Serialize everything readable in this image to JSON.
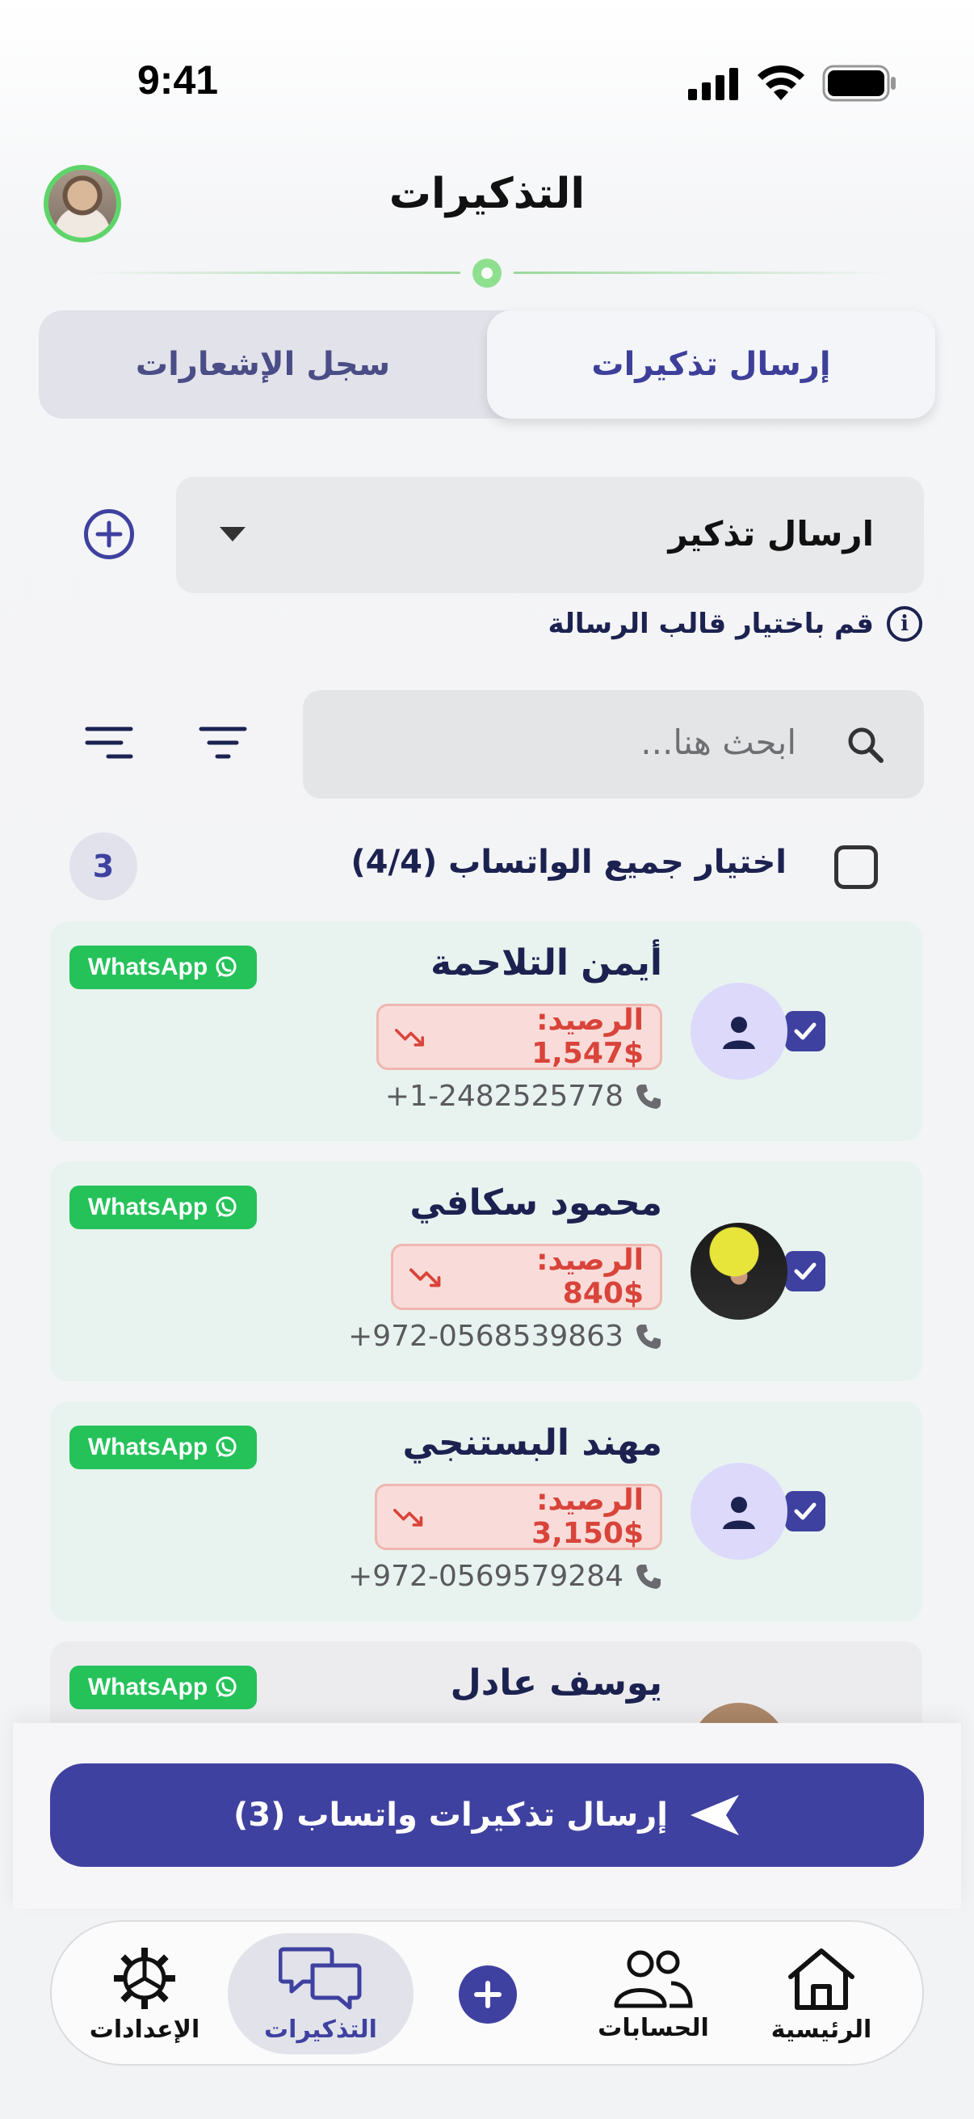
{
  "status_bar": {
    "time": "9:41"
  },
  "header": {
    "title": "التذكيرات"
  },
  "tabs": [
    {
      "label": "إرسال تذكيرات",
      "active": true
    },
    {
      "label": "سجل الإشعارات",
      "active": false
    }
  ],
  "template": {
    "selected": "ارسال تذكير",
    "hint": "قم باختيار قالب الرسالة"
  },
  "search": {
    "placeholder": "ابحث هنا..."
  },
  "select_all": {
    "label": "اختيار جميع الواتساب (4/4)",
    "selected_count": "3",
    "checked": false
  },
  "customers": [
    {
      "name": "أيمن التلاحمة",
      "balance": "الرصيد: $1,547",
      "phone": "+1-2482525778",
      "checked": true,
      "whatsapp": "WhatsApp"
    },
    {
      "name": "محمود سكافي",
      "balance": "الرصيد: $840",
      "phone": "+972-0568539863",
      "checked": true,
      "whatsapp": "WhatsApp"
    },
    {
      "name": "مهند البستنجي",
      "balance": "الرصيد: $3,150",
      "phone": "+972-0569579284",
      "checked": true,
      "whatsapp": "WhatsApp"
    },
    {
      "name": "يوسف عادل",
      "whatsapp": "WhatsApp"
    }
  ],
  "send_button": {
    "label": "إرسال تذكيرات واتساب (3)"
  },
  "bottom_nav": {
    "home": "الرئيسية",
    "accounts": "الحسابات",
    "reminders": "التذكيرات",
    "settings": "الإعدادات",
    "active": "reminders"
  },
  "colors": {
    "primary": "#3f41a0",
    "whatsapp_green": "#25c25a",
    "balance_red": "#d9443a",
    "card_green": "#e8f3ef",
    "accent_green": "#5fd46a"
  }
}
